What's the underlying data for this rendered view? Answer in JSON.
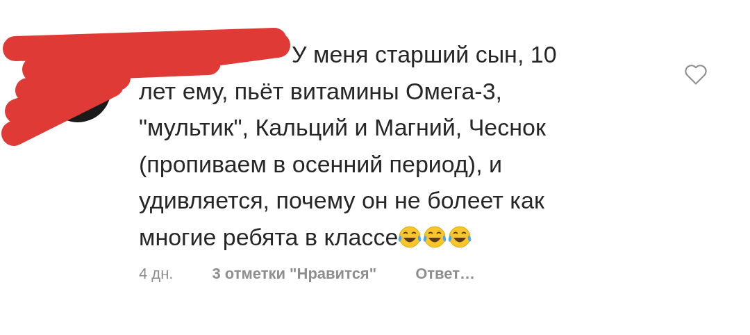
{
  "comment": {
    "text": "У меня старший сын, 10\nлет ему, пьёт витамины Омега-3,\n\"мультик\", Кальций и Магний, Чеснок\n(пропиваем в осенний период), и\nудивляется, почему он не болеет как",
    "last_line": "многие ребята в классе",
    "emojis": [
      {
        "kind": "tears_of_joy"
      },
      {
        "kind": "tears_of_joy"
      },
      {
        "kind": "tears_of_joy"
      }
    ],
    "liked": false,
    "time": "4 дн.",
    "likes": "3 отметки \"Нравится\"",
    "reply": "Ответ…"
  }
}
